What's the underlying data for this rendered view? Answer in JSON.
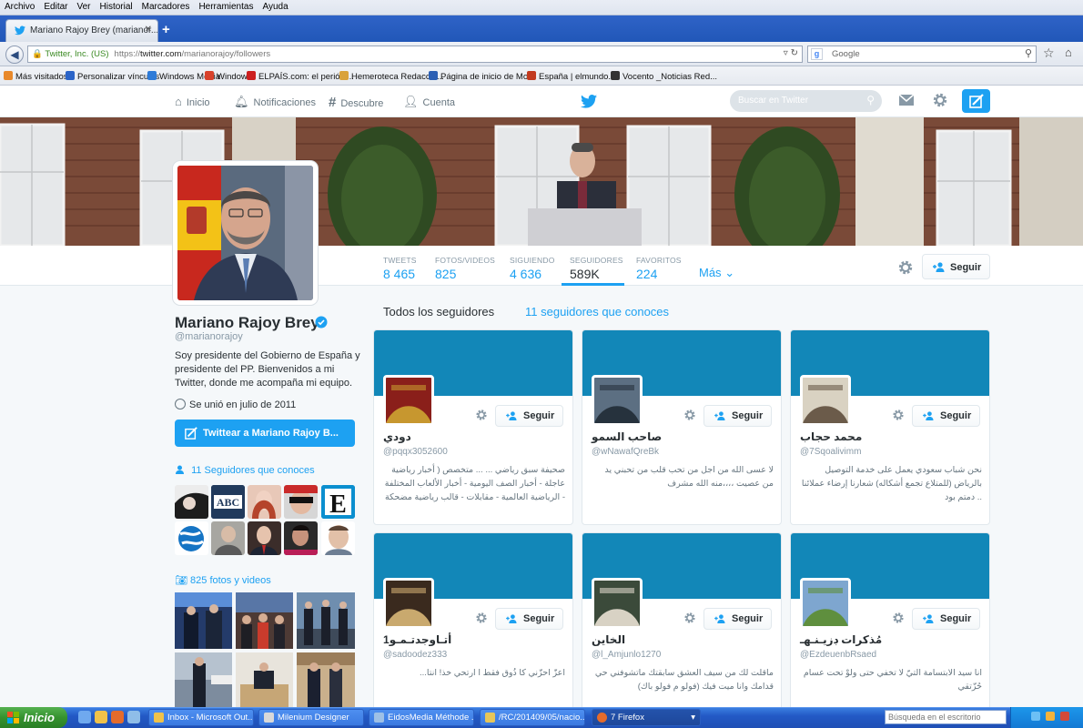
{
  "browser": {
    "menu": [
      "Archivo",
      "Editar",
      "Ver",
      "Historial",
      "Marcadores",
      "Herramientas",
      "Ayuda"
    ],
    "tab_title": "Mariano Rajoy Brey (marianor...",
    "identity": "Twitter, Inc. (US)",
    "url_prefix": "https://",
    "url_domain": "twitter.com",
    "url_path": "/marianorajoy/followers",
    "search_engine_placeholder": "Google",
    "bookmarks": [
      "Más visitados",
      "Personalizar vínculos",
      "Windows Media",
      "Windows",
      "ELPAÍS.com: el periódi...",
      "Hemeroteca Redacció...",
      "Página de inicio de Mo...",
      "España | elmundo.es",
      "Vocento _Noticias Red..."
    ],
    "bookmark_colors": [
      "#e8892b",
      "#2b64c8",
      "#2e7bd8",
      "#d8422b",
      "#cc1f1f",
      "#d9a23a",
      "#2b5fb4",
      "#c23a1f",
      "#333333"
    ]
  },
  "twitter_header": {
    "nav": [
      "Inicio",
      "Notificaciones",
      "Descubre",
      "Cuenta"
    ],
    "search_placeholder": "Buscar en Twitter",
    "brand_color": "#1da1f2"
  },
  "profile": {
    "name": "Mariano Rajoy Brey",
    "handle": "@marianorajoy",
    "bio": "Soy presidente del Gobierno de España y presidente del PP. Bienvenidos a mi Twitter, donde me acompaña mi equipo.",
    "joined": "Se unió en julio de 2011",
    "tweet_to": "Twittear a Mariano Rajoy B...",
    "followers_you_know": "11 Seguidores que conoces",
    "photos_videos": "825 fotos y videos",
    "stats": [
      {
        "label": "TWEETS",
        "value": "8 465"
      },
      {
        "label": "FOTOS/VIDEOS",
        "value": "825"
      },
      {
        "label": "SIGUIENDO",
        "value": "4 636"
      },
      {
        "label": "SEGUIDORES",
        "value": "589K"
      },
      {
        "label": "FAVORITOS",
        "value": "224"
      }
    ],
    "more": "Más",
    "follow": "Seguir"
  },
  "followers_tabs": {
    "all": "Todos los seguidores",
    "known": "11 seguidores que conoces"
  },
  "follower_cards": [
    {
      "name": "دودي",
      "handle": "@pqqx3052600",
      "bio": "صحيفة سبق رياضي ... ... متخصص ( أخبار رياضية عاجلة - أخبار الصف اليومية - أخبار الألعاب المختلفة - الرياضية العالمية - مقابلات - قالب رياضية مضحكة )",
      "follow": "Seguir"
    },
    {
      "name": "صاحب السمو",
      "handle": "@wNawafQreBk",
      "bio": "لا عسى الله من اجل من تحب قلب من تحبني يد من عصيت ،،،،منه الله مشرف",
      "follow": "Seguir"
    },
    {
      "name": "محمد حجاب",
      "handle": "@7Sqoalivimm",
      "bio": "نحن شباب سعودي يعمل على خدمة التوصيل بالرياض (للمتلاع تجمع أشكاله) شعارنا إرضاء عملائنا .. دمتم بود",
      "follow": "Seguir"
    },
    {
      "name": "أتـاوجدتـمـو1",
      "handle": "@sadoodez333",
      "bio": "اعزّ احزّني كا ذُوق فقط ا ارتحي خذ! انتا...",
      "follow": "Seguir"
    },
    {
      "name": "الخاين",
      "handle": "@l_Amjunlo1270",
      "bio": "ماقلت لك من سيف العشق سابقتك ماتشوفني حي قدامك وانا ميت فيك (فولو م فولو باك)",
      "follow": "Seguir"
    },
    {
      "name": "مُذكرات ڊزيـنـهـ",
      "handle": "@EzdeuenbRsaed",
      "bio": "انا سيد الابتسامة التيّ لا تخفي حتى ولوْ تحت عسام حُزّتقي",
      "follow": "Seguir"
    }
  ],
  "taskbar": {
    "start": "Inicio",
    "items": [
      "Inbox - Microsoft Out...",
      "Milenium Designer",
      "EidosMedia Méthode ...",
      "/RC/201409/05/nacio...",
      "7 Firefox"
    ],
    "search_placeholder": "Búsqueda en el escritorio"
  }
}
